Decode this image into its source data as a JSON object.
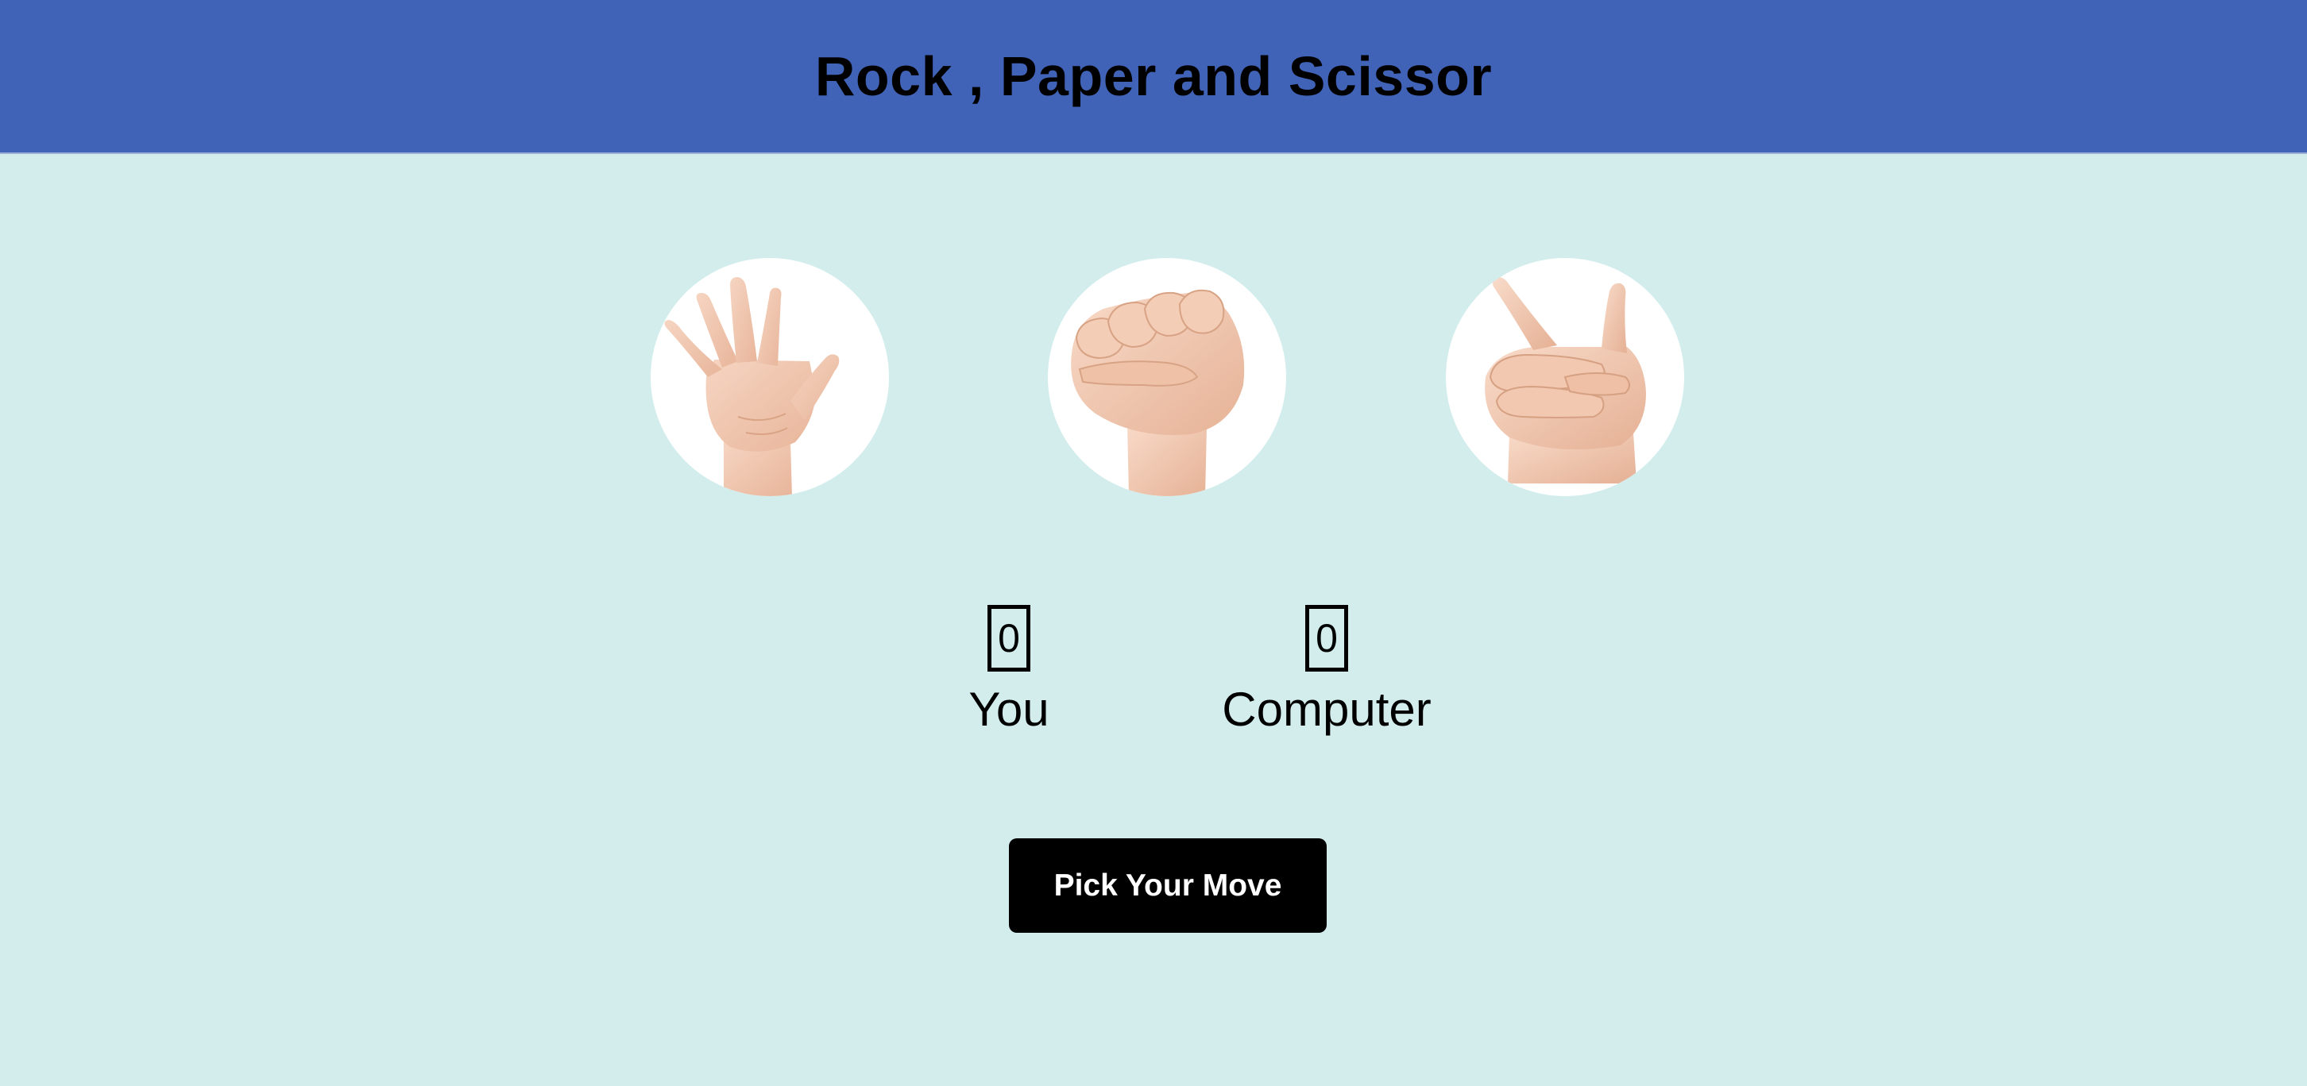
{
  "header": {
    "title": "Rock , Paper and Scissor"
  },
  "choices": [
    {
      "name": "paper",
      "icon": "paper-hand-icon"
    },
    {
      "name": "rock",
      "icon": "rock-hand-icon"
    },
    {
      "name": "scissors",
      "icon": "scissors-hand-icon"
    }
  ],
  "scoreboard": {
    "user_score": "0",
    "user_label": "You",
    "computer_score": "0",
    "computer_label": "Computer"
  },
  "actions": {
    "pick_label": "Pick Your Move"
  },
  "colors": {
    "header_bg": "#4063b8",
    "page_bg": "#d3eded",
    "button_bg": "#000000",
    "skin": "#f2c9b1"
  }
}
